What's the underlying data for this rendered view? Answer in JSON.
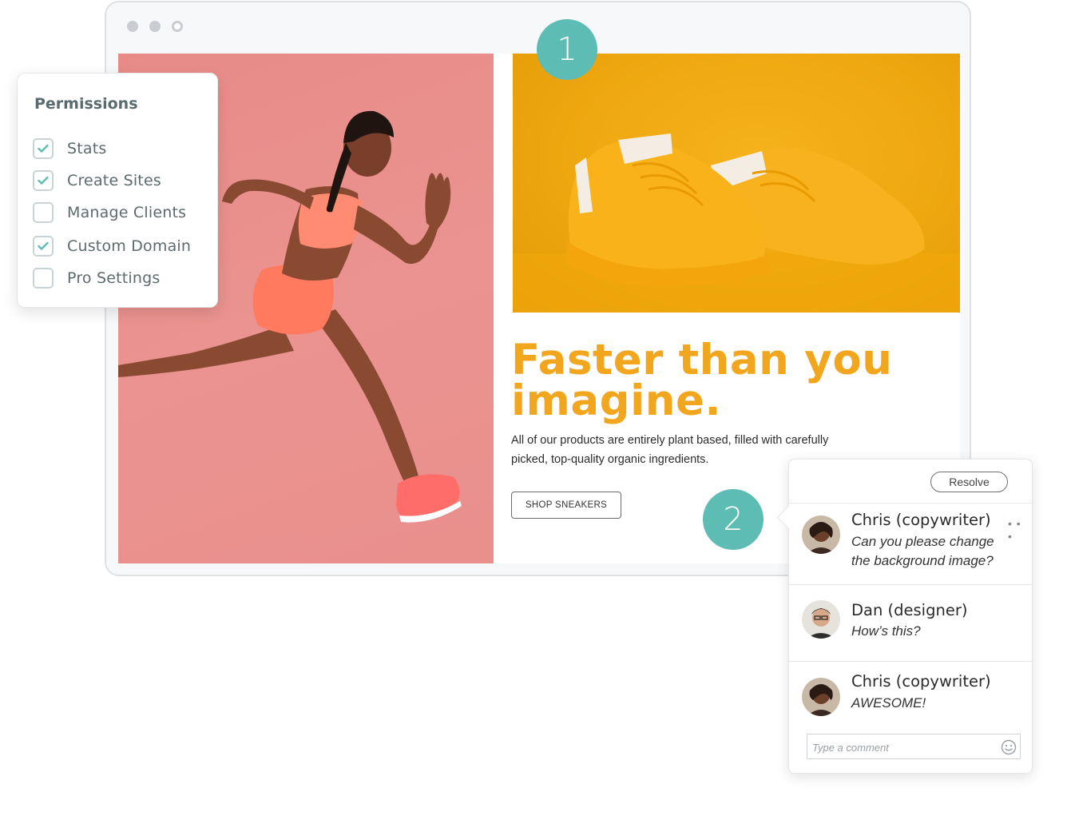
{
  "browser": {
    "dots": [
      "window-dot",
      "window-dot",
      "window-dot-outline"
    ]
  },
  "markers": {
    "first": "1",
    "second": "2"
  },
  "hero": {
    "headline_line1": "Faster than you",
    "headline_line2": "imagine.",
    "body": "All of our products are entirely plant based, filled with carefully picked, top-quality organic ingredients.",
    "cta_label": "SHOP SNEAKERS"
  },
  "permissions": {
    "title": "Permissions",
    "items": [
      {
        "label": "Stats",
        "checked": true
      },
      {
        "label": "Create Sites",
        "checked": true
      },
      {
        "label": "Manage Clients",
        "checked": false
      },
      {
        "label": "Custom Domain",
        "checked": true
      },
      {
        "label": "Pro Settings",
        "checked": false
      }
    ]
  },
  "comments": {
    "resolve_label": "Resolve",
    "thread": [
      {
        "author": "Chris (copywriter)",
        "text": "Can you please change the background image?"
      },
      {
        "author": "Dan (designer)",
        "text": "How’s this?"
      },
      {
        "author": "Chris (copywriter)",
        "text": "AWESOME!"
      }
    ],
    "input_placeholder": "Type a comment"
  },
  "colors": {
    "accent_teal": "#5dbcb3",
    "headline_orange": "#f2a61e",
    "runner_bg": "#e88b88",
    "shoe_bg": "#eea70f"
  }
}
